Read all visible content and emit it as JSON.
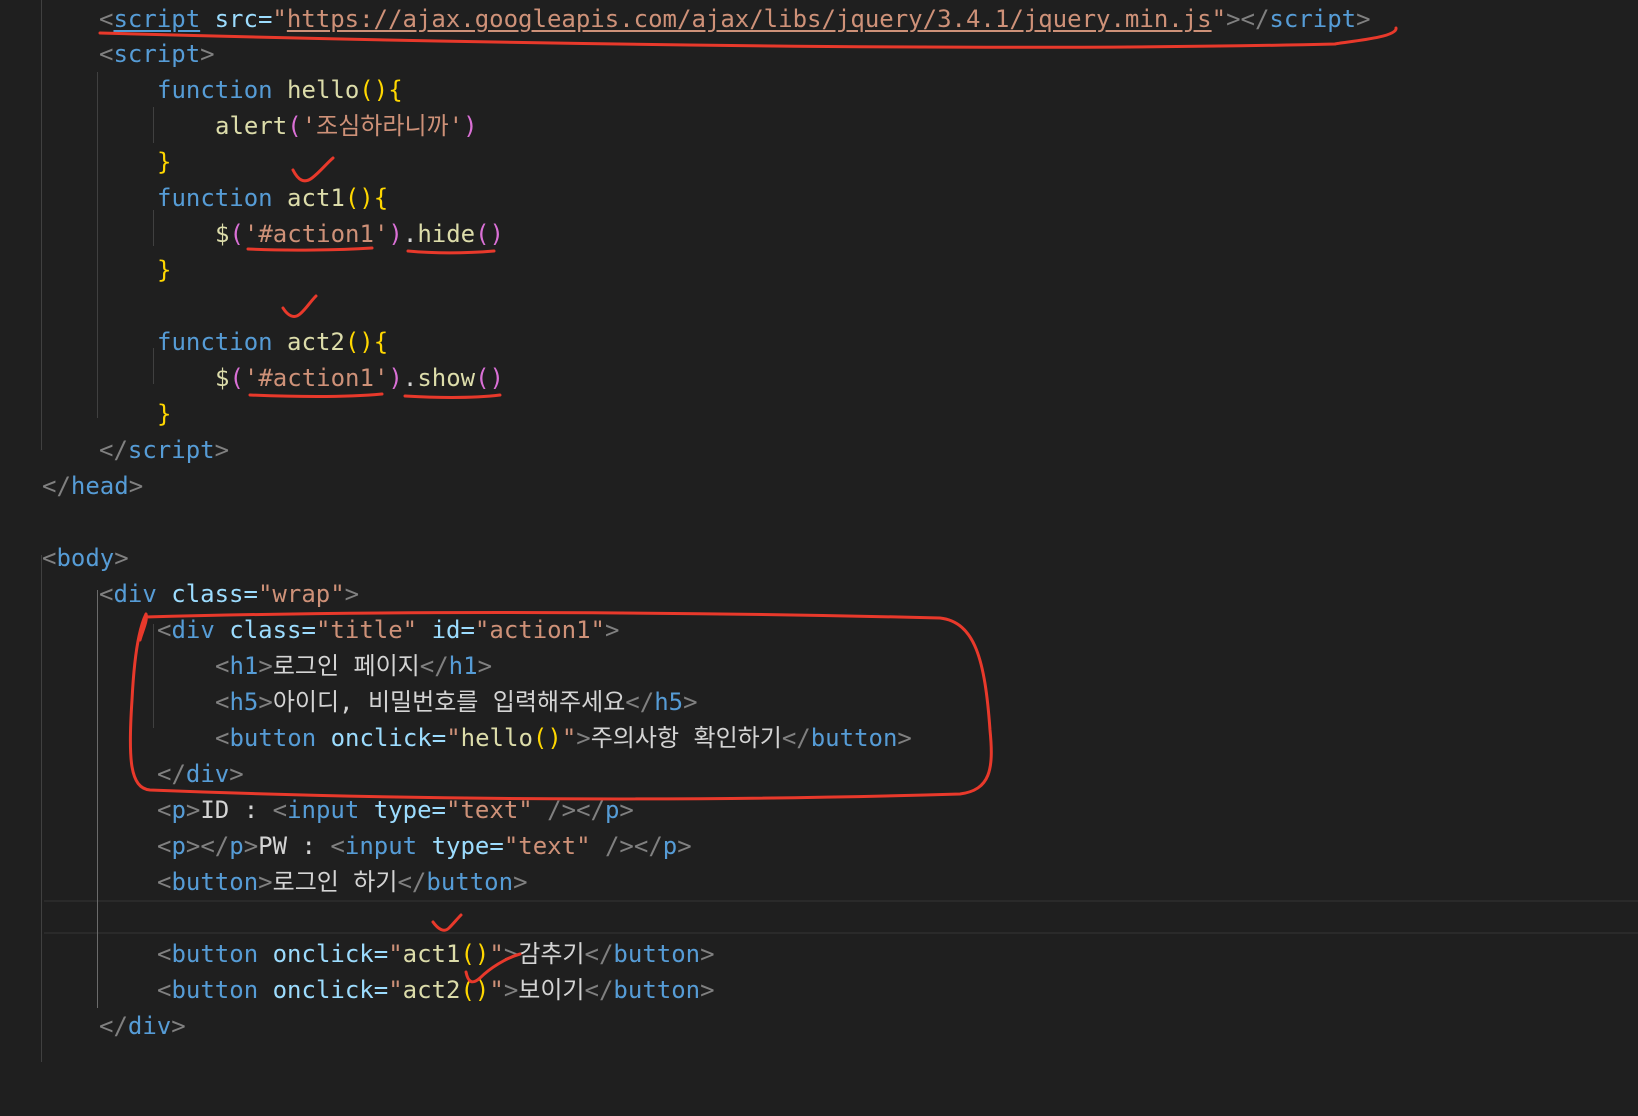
{
  "editor": {
    "lines": [
      {
        "seg": [
          "<",
          "script",
          " src=",
          "\"",
          "https://ajax.googleapis.com/ajax/libs/jquery/3.4.1/jquery.min.js",
          "\"",
          "></",
          "script",
          ">"
        ]
      },
      {
        "seg": [
          "<",
          "script",
          ">"
        ]
      },
      {
        "seg": [
          "function",
          " ",
          "hello",
          "()",
          "{"
        ]
      },
      {
        "seg": [
          "alert",
          "(",
          "'조심하라니까'",
          ")"
        ]
      },
      {
        "seg": [
          "}"
        ]
      },
      {
        "seg": [
          "function",
          " ",
          "act1",
          "()",
          "{"
        ]
      },
      {
        "seg": [
          "$",
          "(",
          "'#action1'",
          ")",
          ".",
          "hide",
          "()"
        ]
      },
      {
        "seg": [
          "}"
        ]
      },
      {
        "seg": []
      },
      {
        "seg": [
          "function",
          " ",
          "act2",
          "()",
          "{"
        ]
      },
      {
        "seg": [
          "$",
          "(",
          "'#action1'",
          ")",
          ".",
          "show",
          "()"
        ]
      },
      {
        "seg": [
          "}"
        ]
      },
      {
        "seg": [
          "</",
          "script",
          ">"
        ]
      },
      {
        "seg": [
          "</",
          "head",
          ">"
        ]
      },
      {
        "seg": []
      },
      {
        "seg": [
          "<",
          "body",
          ">"
        ]
      },
      {
        "seg": [
          "<",
          "div",
          " class=",
          "\"wrap\"",
          ">"
        ]
      },
      {
        "seg": [
          "<",
          "div",
          " class=",
          "\"title\"",
          " id=",
          "\"action1\"",
          ">"
        ]
      },
      {
        "seg": [
          "<",
          "h1",
          ">",
          "로그인 페이지",
          "</",
          "h1",
          ">"
        ]
      },
      {
        "seg": [
          "<",
          "h5",
          ">",
          "아이디, 비밀번호를 입력해주세요",
          "</",
          "h5",
          ">"
        ]
      },
      {
        "seg": [
          "<",
          "button",
          " onclick=",
          "\"",
          "hello",
          "()",
          "\"",
          ">",
          "주의사항 확인하기",
          "</",
          "button",
          ">"
        ]
      },
      {
        "seg": [
          "</",
          "div",
          ">"
        ]
      },
      {
        "seg": [
          "<",
          "p",
          ">",
          "ID : ",
          "<",
          "input",
          " type=",
          "\"text\"",
          " /></",
          "p",
          ">"
        ]
      },
      {
        "seg": [
          "<",
          "p",
          "></",
          "p",
          ">",
          "PW : ",
          "<",
          "input",
          " type=",
          "\"text\"",
          " /></",
          "p",
          ">"
        ]
      },
      {
        "seg": [
          "<",
          "button",
          ">",
          "로그인 하기",
          "</",
          "button",
          ">"
        ]
      },
      {
        "seg": []
      },
      {
        "seg": [
          "<",
          "button",
          " onclick=",
          "\"",
          "act1",
          "()",
          "\"",
          ">",
          "감추기",
          "</",
          "button",
          ">"
        ]
      },
      {
        "seg": [
          "<",
          "button",
          " onclick=",
          "\"",
          "act2",
          "()",
          "\"",
          ">",
          "보이기",
          "</",
          "button",
          ">"
        ]
      },
      {
        "seg": [
          "</",
          "div",
          ">"
        ]
      }
    ]
  },
  "colors": {
    "background": "#1f1f1f",
    "annotation": "#e8392b",
    "tag_bracket": "#808080",
    "tag_name": "#569cd6",
    "attribute": "#9cdcfe",
    "string": "#ce9178",
    "keyword": "#569cd6",
    "function": "#dcdcaa",
    "bracket_yellow": "#ffd700",
    "bracket_purple": "#da70d6"
  }
}
